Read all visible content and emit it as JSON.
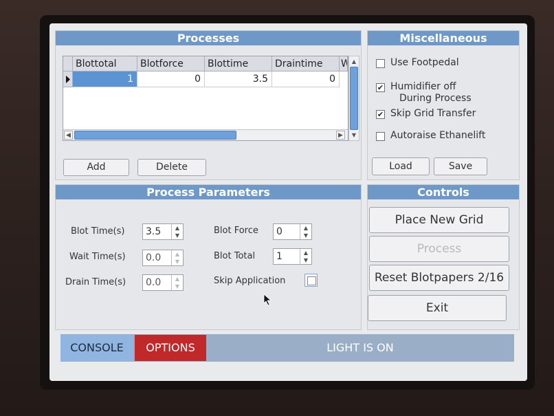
{
  "processes": {
    "title": "Processes",
    "columns": [
      "Blottotal",
      "Blotforce",
      "Blottime",
      "Draintime",
      "W"
    ],
    "rows": [
      [
        "1",
        "0",
        "3.5",
        "0"
      ]
    ],
    "add_label": "Add",
    "delete_label": "Delete"
  },
  "misc": {
    "title": "Miscellaneous",
    "use_footpedal": {
      "label": "Use Footpedal",
      "checked": false
    },
    "humidifier_off": {
      "label_line1": "Humidifier off",
      "label_line2": "During Process",
      "checked": true
    },
    "skip_grid_transfer": {
      "label": "Skip Grid Transfer",
      "checked": true
    },
    "autoraise_ethanelift": {
      "label": "Autoraise Ethanelift",
      "checked": false
    },
    "load_label": "Load",
    "save_label": "Save"
  },
  "params": {
    "title": "Process Parameters",
    "blot_time": {
      "label": "Blot Time(s)",
      "value": "3.5"
    },
    "wait_time": {
      "label": "Wait Time(s)",
      "value": "0.0"
    },
    "drain_time": {
      "label": "Drain Time(s)",
      "value": "0.0"
    },
    "blot_force": {
      "label": "Blot Force",
      "value": "0"
    },
    "blot_total": {
      "label": "Blot Total",
      "value": "1"
    },
    "skip_application": {
      "label": "Skip Application",
      "checked": false
    }
  },
  "controls": {
    "title": "Controls",
    "place_new_grid": "Place New Grid",
    "process": "Process",
    "reset_blotpapers": "Reset Blotpapers 2/16",
    "exit": "Exit"
  },
  "bottom": {
    "console_tab": "CONSOLE",
    "options_tab": "OPTIONS",
    "status": "LIGHT IS ON"
  },
  "icons": {
    "row_indicator": "triangle-right-icon",
    "scroll_up": "chevron-up-icon",
    "scroll_down": "chevron-down-icon",
    "scroll_left": "chevron-left-icon",
    "scroll_right": "chevron-right-icon",
    "check": "check-icon",
    "pointer": "mouse-pointer-icon"
  },
  "colors": {
    "header": "#6e98c8",
    "selected_cell": "#5b93d3",
    "options_tab": "#c0282a",
    "console_tab": "#8fb5e0",
    "status_bar": "#9aaec8"
  }
}
